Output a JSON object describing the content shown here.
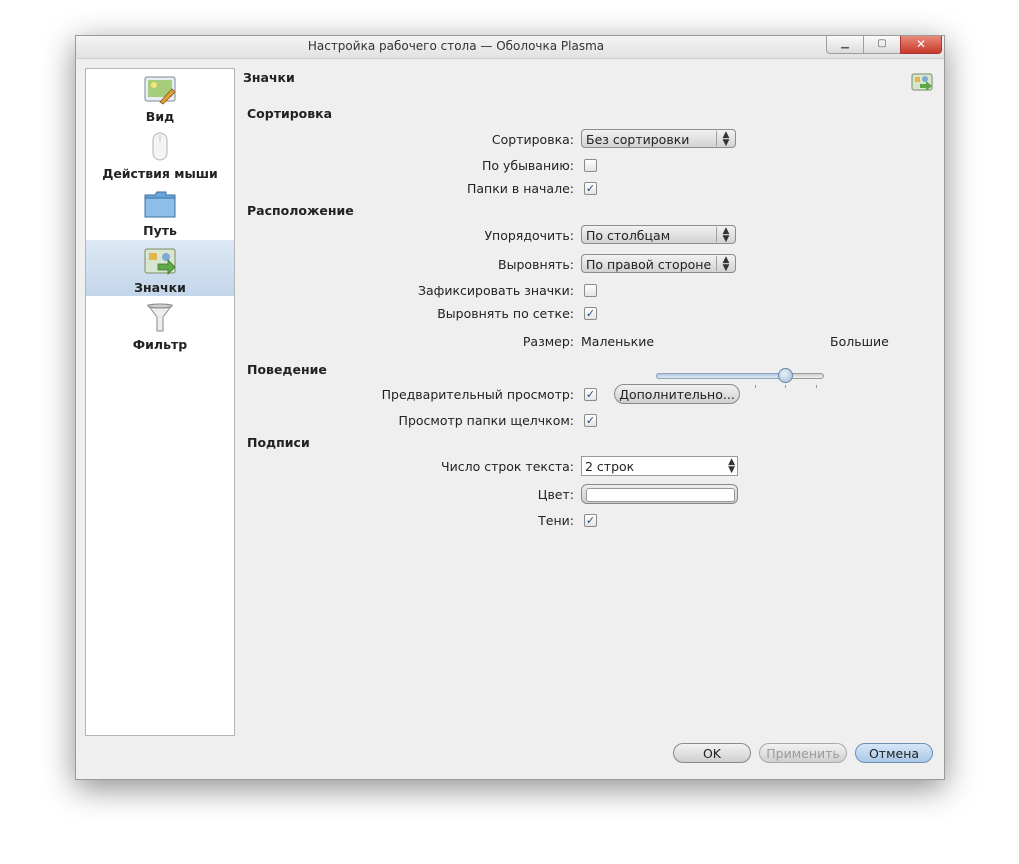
{
  "window": {
    "title": "Настройка рабочего стола — Оболочка Plasma",
    "min_glyph": "▁",
    "max_glyph": "▢",
    "close_glyph": "✕"
  },
  "sidebar": {
    "items": [
      {
        "label": "Вид",
        "icon": "appearance-icon",
        "selected": false
      },
      {
        "label": "Действия мыши",
        "icon": "mouse-icon",
        "selected": false
      },
      {
        "label": "Путь",
        "icon": "folder-icon",
        "selected": false
      },
      {
        "label": "Значки",
        "icon": "icons-icon",
        "selected": true
      },
      {
        "label": "Фильтр",
        "icon": "filter-icon",
        "selected": false
      }
    ]
  },
  "page": {
    "title": "Значки",
    "sections": {
      "sorting": "Сортировка",
      "arrangement": "Расположение",
      "behavior": "Поведение",
      "labels": "Подписи"
    },
    "sort": {
      "label": "Сортировка:",
      "value": "Без сортировки",
      "descending_label": "По убыванию:",
      "descending_checked": false,
      "folders_first_label": "Папки в начале:",
      "folders_first_checked": true
    },
    "arrange": {
      "order_label": "Упорядочить:",
      "order_value": "По столбцам",
      "align_label": "Выровнять:",
      "align_value": "По правой стороне",
      "lock_label": "Зафиксировать значки:",
      "lock_checked": false,
      "grid_label": "Выровнять по сетке:",
      "grid_checked": true,
      "size_label": "Размер:",
      "size_min": "Маленькие",
      "size_max": "Большие",
      "size_level": 0.78
    },
    "behavior": {
      "preview_label": "Предварительный просмотр:",
      "preview_checked": true,
      "more_button": "Дополнительно...",
      "folder_view_label": "Просмотр папки щелчком:",
      "folder_view_checked": true
    },
    "captions": {
      "lines_label": "Число строк текста:",
      "lines_value": "2 строк",
      "color_label": "Цвет:",
      "color_value": "#ffffff",
      "shadows_label": "Тени:",
      "shadows_checked": true
    }
  },
  "buttons": {
    "ok": "OK",
    "apply": "Применить",
    "cancel": "Отмена"
  },
  "colors": {
    "selection": "#c3d6ea",
    "accent": "#6f8fb3"
  }
}
